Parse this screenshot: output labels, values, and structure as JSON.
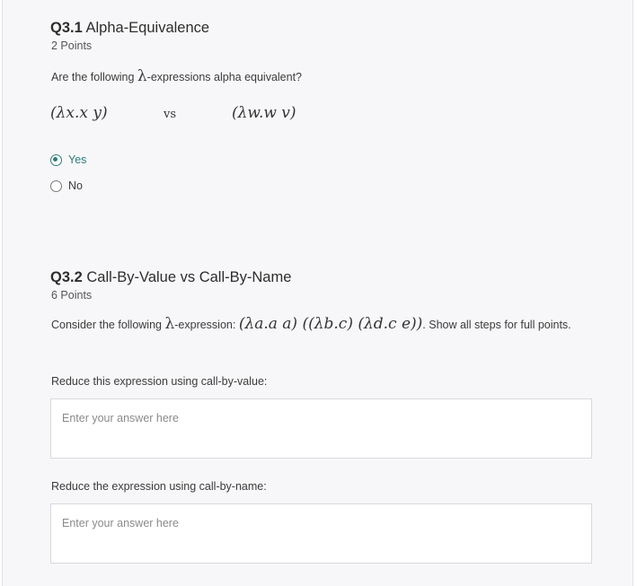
{
  "q31": {
    "number": "Q3.1",
    "title": "Alpha-Equivalence",
    "points": "2 Points",
    "prompt_before": "Are the following ",
    "lambda": "λ",
    "prompt_after": "-expressions alpha equivalent?",
    "expr_left": "(λx.x y)",
    "vs": "vs",
    "expr_right": "(λw.w v)",
    "options": [
      {
        "label": "Yes",
        "checked": true
      },
      {
        "label": "No",
        "checked": false
      }
    ]
  },
  "q32": {
    "number": "Q3.2",
    "title": "Call-By-Value vs Call-By-Name",
    "points": "6 Points",
    "consider_before": "Consider the following ",
    "lambda": "λ",
    "consider_mid": "-expression: ",
    "expression": "(λa.a a) ((λb.c) (λd.c e))",
    "consider_after": ". Show all steps for full points.",
    "cbv_label": "Reduce this expression using call-by-value:",
    "cbv_placeholder": "Enter your answer here",
    "cbn_label": "Reduce the expression using call-by-name:",
    "cbn_placeholder": "Enter your answer here"
  },
  "colors": {
    "accent": "#2e7e77",
    "panel_bg": "#f7f7f9"
  }
}
